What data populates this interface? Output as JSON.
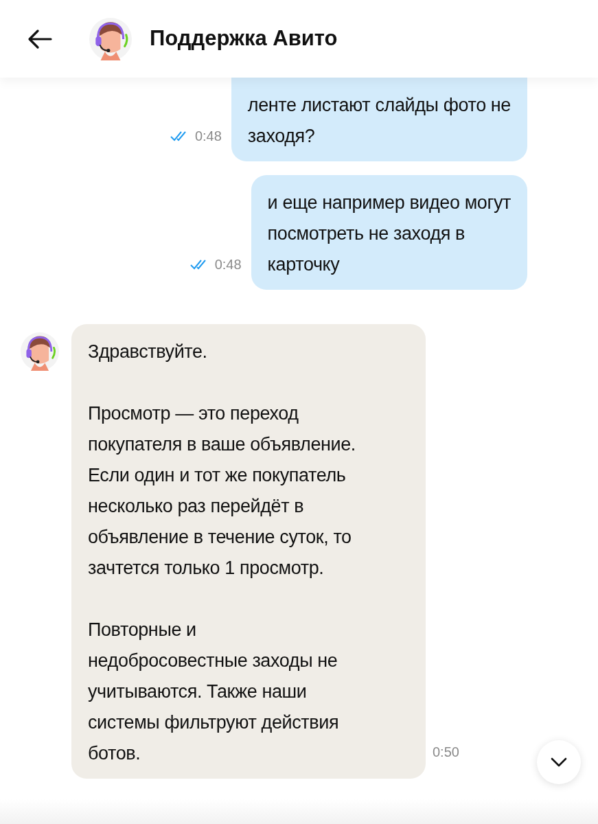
{
  "header": {
    "title": "Поддержка Авито"
  },
  "messages": [
    {
      "kind": "outgoing",
      "cut_top": true,
      "read": true,
      "time": "0:48",
      "paragraphs": [
        [
          "ленте листают слайды  фото не",
          "заходя?"
        ]
      ]
    },
    {
      "kind": "outgoing",
      "cut_top": false,
      "read": true,
      "time": "0:48",
      "paragraphs": [
        [
          "и еще например видео могут",
          "посмотреть не заходя  в",
          "карточку"
        ]
      ]
    },
    {
      "kind": "incoming",
      "cut_top": false,
      "time": "0:50",
      "paragraphs": [
        [
          "Здравствуйте."
        ],
        [
          "Просмотр — это переход",
          "покупателя в ваше объявление.",
          "Если один и тот же покупатель",
          "несколько раз перейдёт в",
          "объявление в течение суток, то",
          "зачтется только 1 просмотр."
        ],
        [
          "Повторные и",
          "недобросовестные заходы не",
          "учитываются. Также наши",
          "системы фильтруют действия",
          "ботов."
        ]
      ]
    }
  ]
}
